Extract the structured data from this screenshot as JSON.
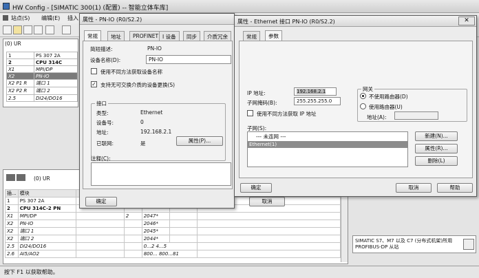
{
  "app": {
    "title": "HW Config - [SIMATIC 300(1) (配置) -- 智能立体车库]"
  },
  "menu": [
    "站点(S)",
    "编辑(E)",
    "插入"
  ],
  "rack_panel": {
    "title": "(0) UR",
    "rows": [
      {
        "slot": "1",
        "module": "PS 307 2A"
      },
      {
        "slot": "2",
        "module": "CPU 314C"
      },
      {
        "slot": "X1",
        "module": "MPI/DP"
      },
      {
        "slot": "X2",
        "module": "PN-IO"
      },
      {
        "slot": "X2 P1 R",
        "module": "端口 1"
      },
      {
        "slot": "X2 P2 R",
        "module": "端口 2"
      },
      {
        "slot": "2.5",
        "module": "DI24/DO16"
      }
    ]
  },
  "lower_panel": {
    "nav_label": "(0)  UR",
    "col_slot": "插...",
    "col_module": "模块",
    "rows": [
      {
        "slot": "1",
        "module": "PS 307 2A",
        "addr": ""
      },
      {
        "slot": "2",
        "module": "CPU 314C-2 PN",
        "addr": ""
      },
      {
        "slot": "X1",
        "module": "MPI/DP",
        "mark": "2",
        "addr": "2047*"
      },
      {
        "slot": "X2",
        "module": "PN-IO",
        "mark": "",
        "addr": "2046*"
      },
      {
        "slot": "X2",
        "module": "端口 1",
        "mark": "",
        "addr": "2045*"
      },
      {
        "slot": "X2",
        "module": "端口 2",
        "mark": "",
        "addr": "2044*"
      },
      {
        "slot": "2.5",
        "module": "DI24/DO16",
        "mark": "",
        "addr": "0...2   4...5"
      },
      {
        "slot": "2.6",
        "module": "AI5/AO2",
        "mark": "",
        "addr": "800...  800...81"
      }
    ]
  },
  "catalog_info": "SIMATIC S7、M7 以及 C7 (分布式机架)所用 PROFIBUS-DP 从站",
  "status": "按下 F1 以获取帮助。",
  "dlg1": {
    "title": "属性 - PN-IO (R0/S2.2)",
    "tabs": [
      "常规",
      "地址",
      "PROFINET",
      "I 设备",
      "同步",
      "介质冗余"
    ],
    "short_desc_label": "简短描述:",
    "short_desc": "PN-IO",
    "device_name_label": "设备名称(D):",
    "device_name": "PN-IO",
    "chk1": "使用不同方法获取设备名称",
    "chk2": "支持无可交换介质的设备更换(S)",
    "iface_group": "接口",
    "type_label": "类型:",
    "type": "Ethernet",
    "devno_label": "设备号:",
    "devno": "0",
    "addr_label": "地址:",
    "addr": "192.168.2.1",
    "net_label": "已联网:",
    "net": "是",
    "prop_btn": "属性(P)...",
    "comment_label": "注释(C):",
    "ok": "确定",
    "cancel": "取消"
  },
  "dlg2": {
    "title": "属性 - Ethernet 接口  PN-IO (R0/S2.2)",
    "tabs": [
      "常规",
      "参数"
    ],
    "ip_label": "IP 地址:",
    "ip": "192.168.2.1",
    "mask_label": "子网掩码(B):",
    "mask": "255.255.255.0",
    "chk_dhcp": "使用不同方法获取 IP 地址",
    "gw_group": "网关",
    "gw_no": "不使用路由器(D)",
    "gw_yes": "使用路由器(U)",
    "gw_addr_label": "地址(A):",
    "subnet_label": "子网(S):",
    "subnet_items": [
      "--- 未连网 ---",
      "Ethernet(1)"
    ],
    "new_btn": "新建(N)...",
    "prop_btn": "属性(R)...",
    "del_btn": "删除(L)",
    "ok": "确定",
    "cancel": "取消",
    "help": "帮助"
  }
}
